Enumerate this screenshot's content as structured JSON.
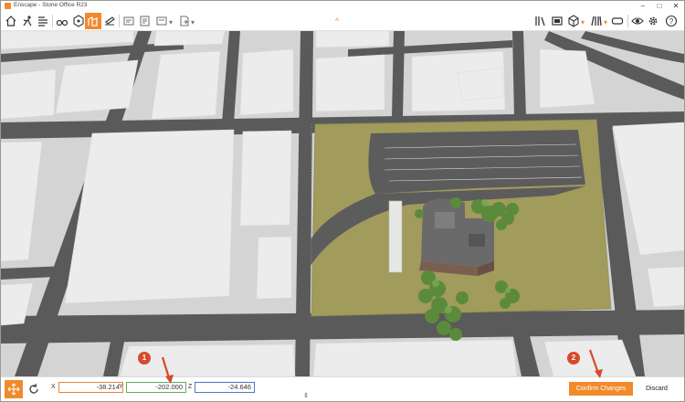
{
  "window": {
    "title": "Enscape - Stone Office R23"
  },
  "toolbar": {
    "tools": [
      {
        "name": "home-icon"
      },
      {
        "name": "walk-mode-icon"
      },
      {
        "name": "views-list-icon"
      },
      {
        "name": "binoculars-icon"
      },
      {
        "name": "reference-icon"
      },
      {
        "name": "asset-placement-icon",
        "active": true
      },
      {
        "name": "sketch-icon"
      },
      {
        "name": "screenshot-icon"
      },
      {
        "name": "batch-render-icon"
      },
      {
        "name": "video-editor-icon"
      },
      {
        "name": "export-icon"
      },
      {
        "name": "library-icon"
      },
      {
        "name": "materials-icon"
      },
      {
        "name": "cube-icon"
      },
      {
        "name": "books-icon"
      },
      {
        "name": "vr-headset-icon"
      },
      {
        "name": "visual-settings-icon"
      },
      {
        "name": "settings-icon"
      },
      {
        "name": "help-icon"
      }
    ],
    "collapse_chevron": "^"
  },
  "bottombar": {
    "x_label": "X",
    "y_label": "Y",
    "z_label": "Z",
    "x_value": "-38.214",
    "y_value": "-202.000",
    "z_value": "-24.646",
    "confirm_label": "Confirm Changes",
    "discard_label": "Discard"
  },
  "callouts": {
    "one": "1",
    "two": "2"
  },
  "colors": {
    "accent": "#f18a2a",
    "x_axis": "#e8863a",
    "y_axis": "#5aae5a",
    "z_axis": "#4a78c8",
    "callout": "#d84a2b"
  }
}
